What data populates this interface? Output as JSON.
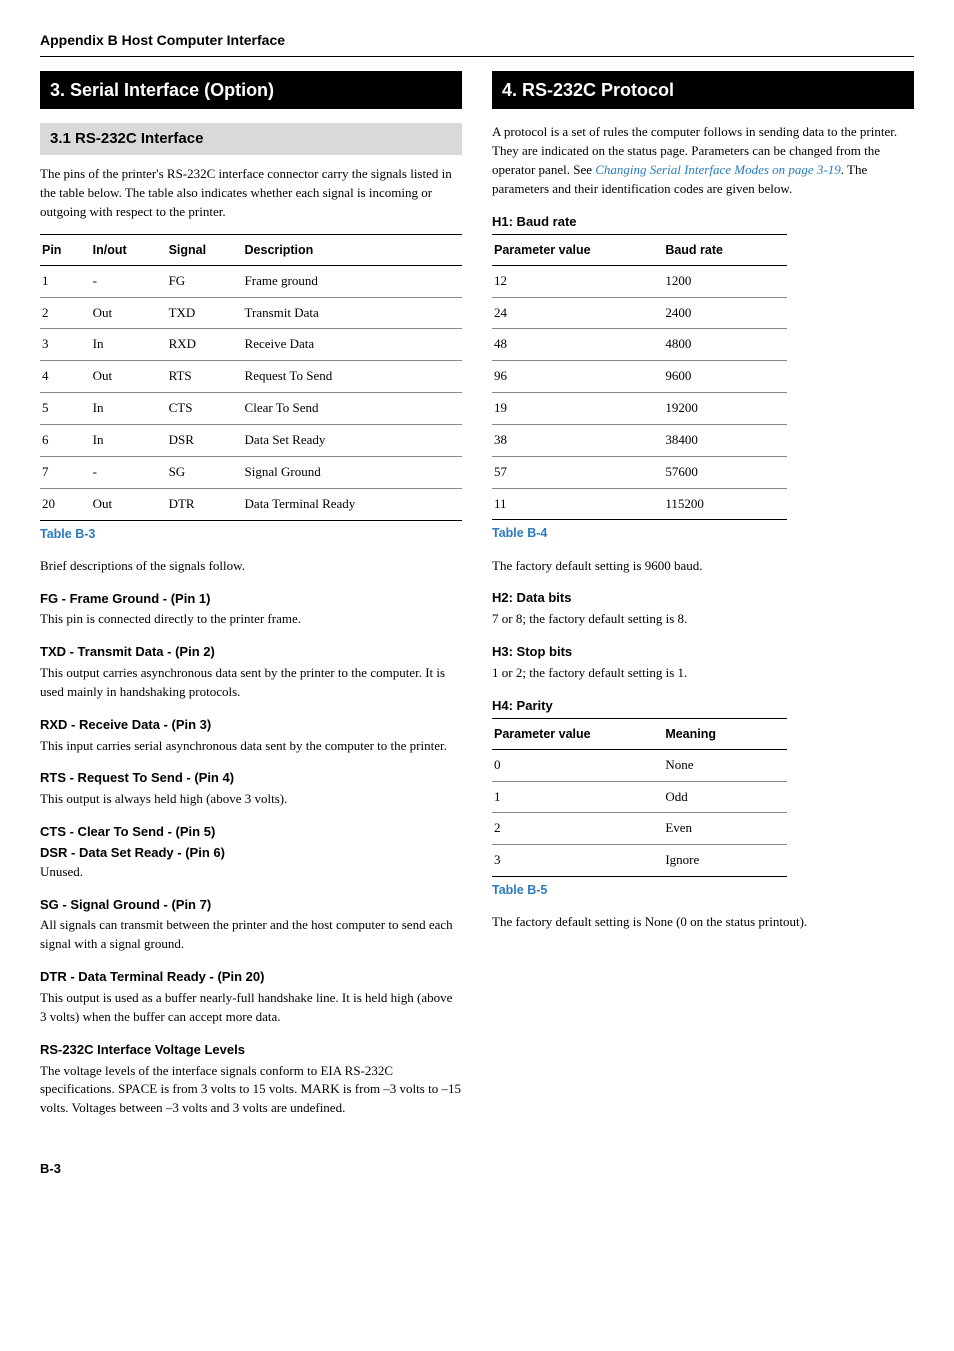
{
  "header": "Appendix B  Host Computer Interface",
  "left": {
    "h1": "3. Serial Interface (Option)",
    "h2": "3.1 RS-232C Interface",
    "intro": "The pins of the printer's RS-232C interface connector carry the signals listed in the table below. The table also indicates whether each signal is incoming or outgoing with respect to the printer.",
    "pin_table": {
      "headers": [
        "Pin",
        "In/out",
        "Signal",
        "Description"
      ],
      "rows": [
        [
          "1",
          "-",
          "FG",
          "Frame ground"
        ],
        [
          "2",
          "Out",
          "TXD",
          "Transmit Data"
        ],
        [
          "3",
          "In",
          "RXD",
          "Receive Data"
        ],
        [
          "4",
          "Out",
          "RTS",
          "Request To Send"
        ],
        [
          "5",
          "In",
          "CTS",
          "Clear To Send"
        ],
        [
          "6",
          "In",
          "DSR",
          "Data Set Ready"
        ],
        [
          "7",
          "-",
          "SG",
          "Signal Ground"
        ],
        [
          "20",
          "Out",
          "DTR",
          "Data Terminal Ready"
        ]
      ],
      "caption": "Table B-3"
    },
    "brief": "Brief descriptions of the signals follow.",
    "sig_fg_h": "FG - Frame Ground - (Pin 1)",
    "sig_fg_b": "This pin is connected directly to the printer frame.",
    "sig_txd_h": "TXD - Transmit Data - (Pin 2)",
    "sig_txd_b": "This output carries asynchronous data sent by the printer to the computer. It is used mainly in handshaking protocols.",
    "sig_rxd_h": "RXD - Receive Data - (Pin 3)",
    "sig_rxd_b": "This input carries serial asynchronous data sent by the computer to the printer.",
    "sig_rts_h": "RTS - Request To Send - (Pin 4)",
    "sig_rts_b": "This output is always held high (above 3 volts).",
    "sig_cts_h": "CTS - Clear To Send - (Pin 5)",
    "sig_dsr_h": "DSR - Data Set Ready - (Pin 6)",
    "sig_unused": "Unused.",
    "sig_sg_h": "SG - Signal Ground - (Pin 7)",
    "sig_sg_b": "All signals can transmit between the printer and the host computer to send each signal with a signal ground.",
    "sig_dtr_h": "DTR - Data Terminal Ready - (Pin 20)",
    "sig_dtr_b": "This output is used as a buffer nearly-full handshake line. It is held high (above 3 volts) when the buffer can accept more data.",
    "volt_h": "RS-232C Interface Voltage Levels",
    "volt_b": "The voltage levels of the interface signals conform to EIA RS-232C specifications. SPACE is from 3 volts to 15 volts. MARK is from –3 volts to –15 volts. Voltages between –3 volts and 3 volts are undefined."
  },
  "right": {
    "h1": "4. RS-232C Protocol",
    "intro_pre": "A protocol is a set of rules the computer follows in sending data to the printer. They are indicated on the status page. Parameters can be changed from the operator panel. See ",
    "intro_link": "Changing Serial Interface Modes on page 3-19",
    "intro_post": ". The parameters and their identification codes are given below.",
    "h1_baud": "H1: Baud rate",
    "baud_table": {
      "headers": [
        "Parameter value",
        "Baud rate"
      ],
      "rows": [
        [
          "12",
          "1200"
        ],
        [
          "24",
          "2400"
        ],
        [
          "48",
          "4800"
        ],
        [
          "96",
          "9600"
        ],
        [
          "19",
          "19200"
        ],
        [
          "38",
          "38400"
        ],
        [
          "57",
          "57600"
        ],
        [
          "11",
          "115200"
        ]
      ],
      "caption": "Table B-4"
    },
    "baud_note": "The factory default setting is 9600 baud.",
    "h2_data": "H2: Data bits",
    "h2_body": "7 or 8; the factory default setting is 8.",
    "h3_stop": "H3: Stop bits",
    "h3_body": "1 or 2; the factory default setting is 1.",
    "h4_parity": "H4: Parity",
    "parity_table": {
      "headers": [
        "Parameter value",
        "Meaning"
      ],
      "rows": [
        [
          "0",
          "None"
        ],
        [
          "1",
          "Odd"
        ],
        [
          "2",
          "Even"
        ],
        [
          "3",
          "Ignore"
        ]
      ],
      "caption": "Table B-5"
    },
    "parity_note": "The factory default setting is None (0 on the status printout)."
  },
  "page_num": "B-3"
}
